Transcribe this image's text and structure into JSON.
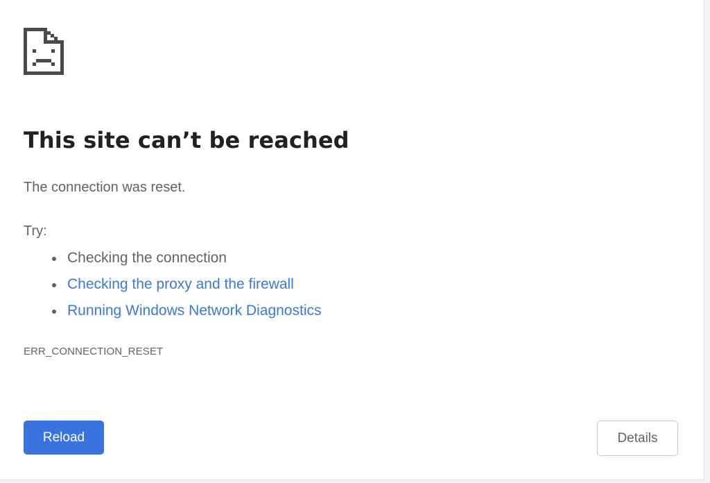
{
  "error_page": {
    "icon": "sad-page-icon",
    "title": "This site can’t be reached",
    "message": "The connection was reset.",
    "try_label": "Try:",
    "suggestions": [
      {
        "text": "Checking the connection",
        "is_link": false
      },
      {
        "text": "Checking the proxy and the firewall",
        "is_link": true
      },
      {
        "text": "Running Windows Network Diagnostics",
        "is_link": true
      }
    ],
    "error_code": "ERR_CONNECTION_RESET"
  },
  "buttons": {
    "reload_label": "Reload",
    "details_label": "Details"
  },
  "colors": {
    "link": "#3c78d8",
    "primary_button": "#3a73e0",
    "text_primary": "#202124",
    "text_secondary": "#5f6368"
  }
}
